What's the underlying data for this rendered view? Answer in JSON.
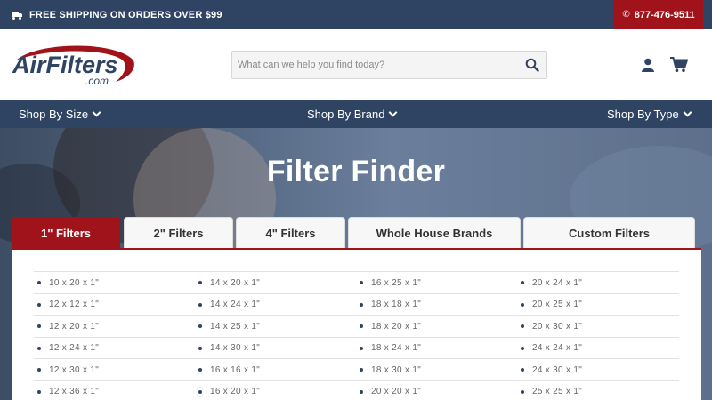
{
  "topbar": {
    "shipping_text": "FREE SHIPPING ON ORDERS OVER $99",
    "phone": "877-476-9511"
  },
  "header": {
    "logo_main": "AirFilters",
    "logo_sub": ".com",
    "search_placeholder": "What can we help you find today?"
  },
  "nav": {
    "items": [
      {
        "label": "Shop By Size"
      },
      {
        "label": "Shop By Brand"
      },
      {
        "label": "Shop By Type"
      }
    ]
  },
  "hero": {
    "title": "Filter Finder"
  },
  "tabs": [
    {
      "label": "1\" Filters",
      "active": true
    },
    {
      "label": "2\" Filters",
      "active": false
    },
    {
      "label": "4\" Filters",
      "active": false
    },
    {
      "label": "Whole House Brands",
      "active": false
    },
    {
      "label": "Custom Filters",
      "active": false
    }
  ],
  "sizes": {
    "columns": [
      [
        "10 x 20 x 1\"",
        "12 x 12 x 1\"",
        "12 x 20 x 1\"",
        "12 x 24 x 1\"",
        "12 x 30 x 1\"",
        "12 x 36 x 1\""
      ],
      [
        "14 x 20 x 1\"",
        "14 x 24 x 1\"",
        "14 x 25 x 1\"",
        "14 x 30 x 1\"",
        "16 x 16 x 1\"",
        "16 x 20 x 1\""
      ],
      [
        "16 x 25 x 1\"",
        "18 x 18 x 1\"",
        "18 x 20 x 1\"",
        "18 x 24 x 1\"",
        "18 x 30 x 1\"",
        "20 x 20 x 1\""
      ],
      [
        "20 x 24 x 1\"",
        "20 x 25 x 1\"",
        "20 x 30 x 1\"",
        "24 x 24 x 1\"",
        "24 x 30 x 1\"",
        "25 x 25 x 1\""
      ]
    ]
  },
  "colors": {
    "navy": "#2f4463",
    "brand_red": "#a0131a"
  }
}
